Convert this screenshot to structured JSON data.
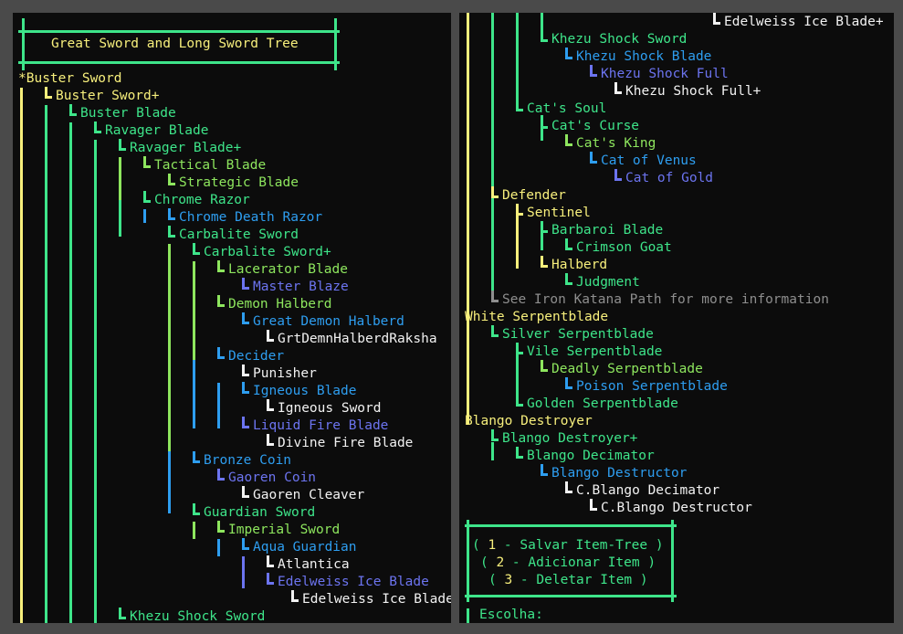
{
  "title": "Great Sword and Long Sword Tree",
  "colors": {
    "yellow": "#f7ef7c",
    "green": "#3ee58a",
    "lime": "#8ee65e",
    "blue": "#2e9ef0",
    "violet": "#6c74f0",
    "white": "#f2f2f2",
    "gray": "#8e8e8e"
  },
  "left_tree": [
    {
      "text": "*Buster Sword",
      "color": "yellow"
    },
    {
      "text": "Buster Sword+",
      "color": "yellow"
    },
    {
      "text": "Buster Blade",
      "color": "green"
    },
    {
      "text": "Ravager Blade",
      "color": "green"
    },
    {
      "text": "Ravager Blade+",
      "color": "green"
    },
    {
      "text": "Tactical Blade",
      "color": "lime"
    },
    {
      "text": "Strategic Blade",
      "color": "lime"
    },
    {
      "text": "Chrome Razor",
      "color": "green"
    },
    {
      "text": "Chrome Death Razor",
      "color": "blue"
    },
    {
      "text": "Carbalite Sword",
      "color": "green"
    },
    {
      "text": "Carbalite Sword+",
      "color": "green"
    },
    {
      "text": "Lacerator Blade",
      "color": "lime"
    },
    {
      "text": "Master Blaze",
      "color": "violet"
    },
    {
      "text": "Demon Halberd",
      "color": "lime"
    },
    {
      "text": "Great Demon Halberd",
      "color": "blue"
    },
    {
      "text": "GrtDemnHalberdRaksha",
      "color": "white"
    },
    {
      "text": "Decider",
      "color": "blue"
    },
    {
      "text": "Punisher",
      "color": "white"
    },
    {
      "text": "Igneous Blade",
      "color": "blue"
    },
    {
      "text": "Igneous Sword",
      "color": "white"
    },
    {
      "text": "Liquid Fire Blade",
      "color": "violet"
    },
    {
      "text": "Divine Fire Blade",
      "color": "white"
    },
    {
      "text": "Bronze Coin",
      "color": "blue"
    },
    {
      "text": "Gaoren Coin",
      "color": "violet"
    },
    {
      "text": "Gaoren Cleaver",
      "color": "white"
    },
    {
      "text": "Guardian Sword",
      "color": "green"
    },
    {
      "text": "Imperial Sword",
      "color": "lime"
    },
    {
      "text": "Aqua Guardian",
      "color": "blue"
    },
    {
      "text": "Atlantica",
      "color": "white"
    },
    {
      "text": "Edelweiss Ice Blade",
      "color": "violet"
    },
    {
      "text": "Edelweiss Ice Blade+",
      "color": "white"
    },
    {
      "text": "Khezu Shock Sword",
      "color": "green"
    }
  ],
  "right_tree": [
    {
      "text": "Edelweiss Ice Blade+",
      "color": "white"
    },
    {
      "text": "Khezu Shock Sword",
      "color": "green"
    },
    {
      "text": "Khezu Shock Blade",
      "color": "blue"
    },
    {
      "text": "Khezu Shock Full",
      "color": "violet"
    },
    {
      "text": "Khezu Shock Full+",
      "color": "white"
    },
    {
      "text": "Cat's Soul",
      "color": "green"
    },
    {
      "text": "Cat's Curse",
      "color": "green"
    },
    {
      "text": "Cat's King",
      "color": "lime"
    },
    {
      "text": "Cat of Venus",
      "color": "blue"
    },
    {
      "text": "Cat of Gold",
      "color": "violet"
    },
    {
      "text": "Defender",
      "color": "yellow"
    },
    {
      "text": "Sentinel",
      "color": "yellow"
    },
    {
      "text": "Barbaroi Blade",
      "color": "green"
    },
    {
      "text": "Crimson Goat",
      "color": "green"
    },
    {
      "text": "Halberd",
      "color": "yellow"
    },
    {
      "text": "Judgment",
      "color": "green"
    },
    {
      "text": "See Iron Katana Path for more information",
      "color": "gray"
    },
    {
      "text": "White Serpentblade",
      "color": "yellow"
    },
    {
      "text": "Silver Serpentblade",
      "color": "green"
    },
    {
      "text": "Vile Serpentblade",
      "color": "green"
    },
    {
      "text": "Deadly Serpentblade",
      "color": "lime"
    },
    {
      "text": "Poison Serpentblade",
      "color": "blue"
    },
    {
      "text": "Golden Serpentblade",
      "color": "green"
    },
    {
      "text": "Blango Destroyer",
      "color": "yellow"
    },
    {
      "text": "Blango Destroyer+",
      "color": "green"
    },
    {
      "text": "Blango Decimator",
      "color": "green"
    },
    {
      "text": "Blango Destructor",
      "color": "blue"
    },
    {
      "text": "C.Blango Decimator",
      "color": "white"
    },
    {
      "text": "C.Blango Destructor",
      "color": "white"
    }
  ],
  "menu": {
    "options": [
      {
        "num": "1",
        "label": "Salvar Item-Tree"
      },
      {
        "num": "2",
        "label": "Adicionar Item"
      },
      {
        "num": "3",
        "label": "Deletar Item"
      }
    ],
    "prompt": "Escolha:"
  }
}
